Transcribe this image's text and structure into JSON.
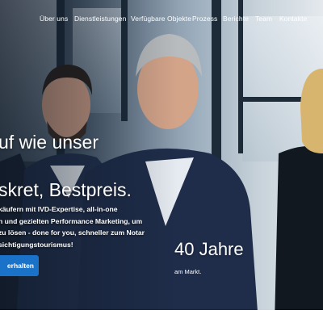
{
  "nav": {
    "items": [
      {
        "label": "Über uns"
      },
      {
        "label": "Dienstleistungen"
      },
      {
        "label": "Verfügbare Objekte"
      },
      {
        "label": "Prozess"
      },
      {
        "label": "Berichte"
      },
      {
        "label": "Team"
      },
      {
        "label": "Kontakte"
      }
    ]
  },
  "hero": {
    "headline_line1": "uf wie unser",
    "headline_line2": "skret, Bestpreis.",
    "description_lines": [
      "käufern mit IVD-Expertise, all-in-one",
      "n und gezielten Performance Marketing, um",
      "zu lösen - done for you, schneller zum Notar",
      "sichtigungstourismus!"
    ],
    "cta_label": "erhalten"
  },
  "stat": {
    "value": "40 Jahre",
    "label": "am Markt."
  },
  "colors": {
    "accent": "#1a73c9",
    "suit": "#1f2d4a",
    "window_frame": "#1d2b39"
  }
}
